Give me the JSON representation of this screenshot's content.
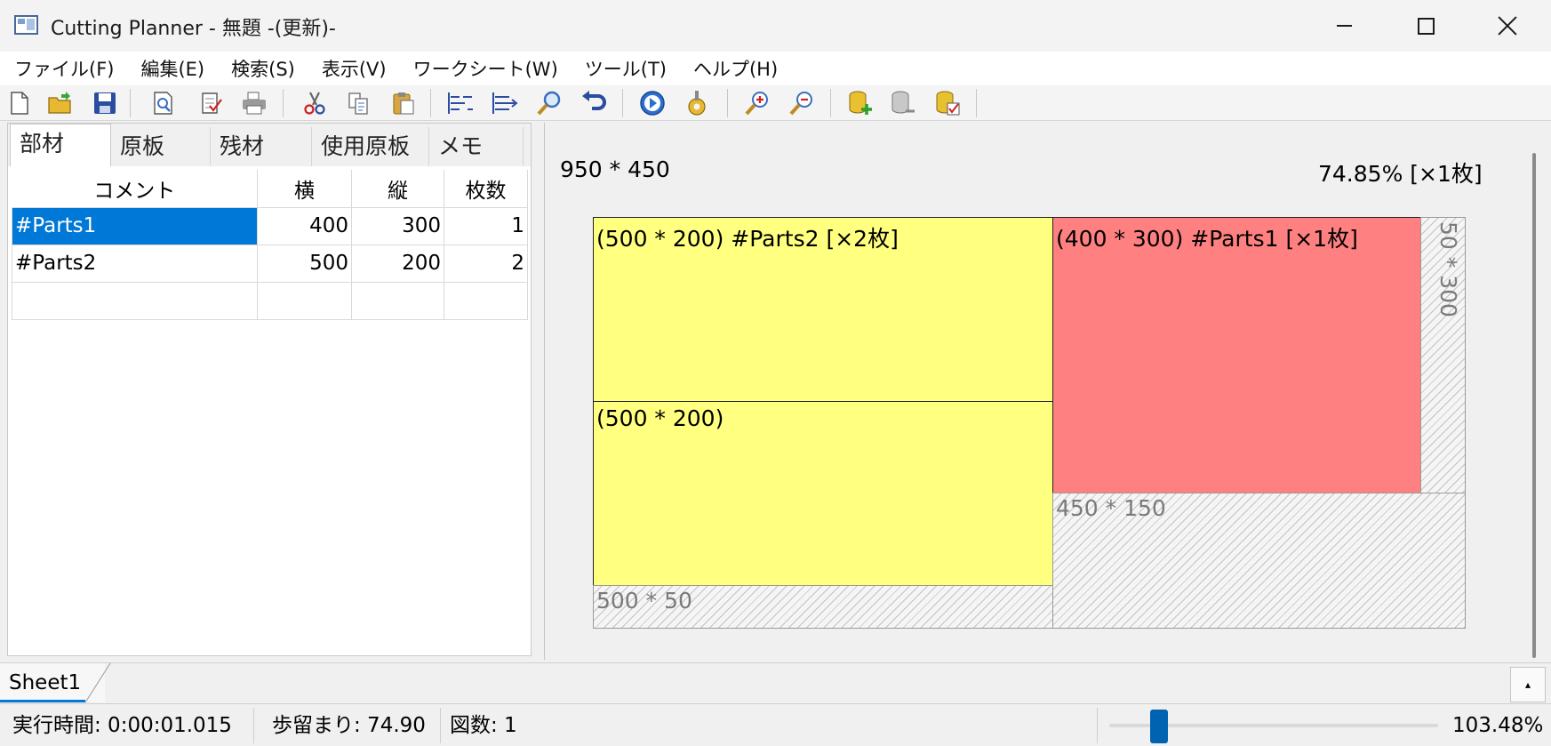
{
  "window": {
    "title": "Cutting Planner - 無題 -(更新)-"
  },
  "menu": [
    "ファイル(F)",
    "編集(E)",
    "検索(S)",
    "表示(V)",
    "ワークシート(W)",
    "ツール(T)",
    "ヘルプ(H)"
  ],
  "toolbar": {
    "icons": [
      "new-file-icon",
      "open-folder-icon",
      "save-icon",
      "print-preview-icon",
      "checklist-icon",
      "printer-icon",
      "cut-icon",
      "copy-icon",
      "paste-icon",
      "align-left-icon",
      "align-right-icon",
      "search-icon",
      "undo-icon",
      "play-icon",
      "settings-cog-icon",
      "zoom-in-icon",
      "zoom-out-icon",
      "database-add-icon",
      "database-icon",
      "database-check-icon"
    ]
  },
  "tabs": [
    "部材",
    "原板",
    "残材",
    "使用原板",
    "メモ"
  ],
  "parts_table": {
    "columns": [
      "コメント",
      "横",
      "縦",
      "枚数"
    ],
    "rows": [
      {
        "comment": "#Parts1",
        "w": "400",
        "h": "300",
        "qty": "1"
      },
      {
        "comment": "#Parts2",
        "w": "500",
        "h": "200",
        "qty": "2"
      }
    ]
  },
  "canvas": {
    "board_size": "950 * 450",
    "yield": "74.85% [×1枚]",
    "pieces": [
      {
        "label": "(500 * 200) #Parts2 [×2枚]",
        "color": "#ffff80"
      },
      {
        "label": "(500 * 200)",
        "color": "#ffff80"
      },
      {
        "label": "(400 * 300) #Parts1 [×1枚]",
        "color": "#ff8080"
      }
    ],
    "scraps": [
      "50 * 300",
      "450 * 150",
      "500 * 50"
    ]
  },
  "sheet": {
    "name": "Sheet1"
  },
  "status": {
    "time": "実行時間: 0:00:01.015",
    "yield": "歩留まり: 74.90",
    "count": "図数: 1",
    "zoom": "103.48%",
    "zoom_level_fraction": 0.13
  },
  "colors": {
    "accent": "#0078d7",
    "piece_yellow": "#ffff80",
    "piece_red": "#ff8080"
  }
}
